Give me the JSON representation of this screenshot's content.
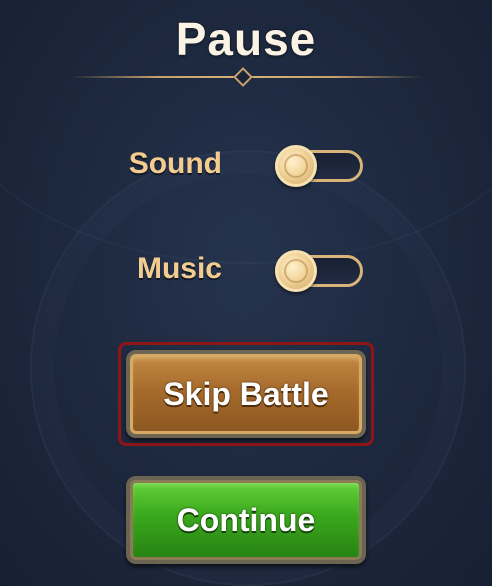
{
  "dialog": {
    "title": "Pause"
  },
  "settings": {
    "sound": {
      "label": "Sound",
      "enabled": false
    },
    "music": {
      "label": "Music",
      "enabled": false
    }
  },
  "buttons": {
    "skip_battle": "Skip Battle",
    "continue": "Continue"
  },
  "colors": {
    "label_gold": "#f3cd8f",
    "skip_button": "#a76c2d",
    "continue_button": "#3aa81d",
    "highlight_frame": "#8e1616",
    "background": "#1e2a40"
  }
}
